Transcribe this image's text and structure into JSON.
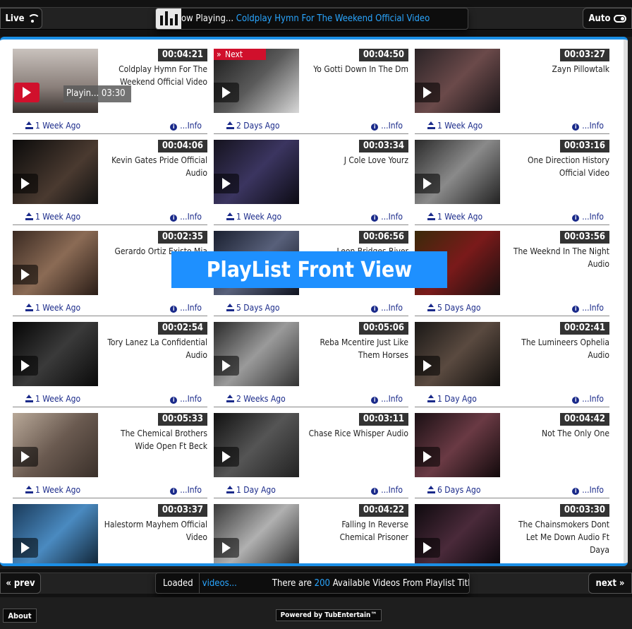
{
  "topbar": {
    "live_label": "Live",
    "auto_label": "Auto",
    "now_playing_prefix": "ow Playing...",
    "now_playing_title": "Coldplay Hymn For The Weekend Official Video"
  },
  "overlay": {
    "text": "PlayList Front View"
  },
  "badges": {
    "playing": "Playin... 03:30",
    "next": "Next"
  },
  "info_label": "...Info",
  "videos": [
    {
      "duration": "00:04:21",
      "title": "Coldplay Hymn For The Weekend Official Video",
      "ago": "1 Week Ago"
    },
    {
      "duration": "00:04:50",
      "title": "Yo Gotti Down In The Dm",
      "ago": "2 Days Ago"
    },
    {
      "duration": "00:03:27",
      "title": "Zayn Pillowtalk",
      "ago": "1 Week Ago"
    },
    {
      "duration": "00:04:06",
      "title": "Kevin Gates Pride Official Audio",
      "ago": "1 Week Ago"
    },
    {
      "duration": "00:03:34",
      "title": "J Cole Love Yourz",
      "ago": "1 Week Ago"
    },
    {
      "duration": "00:03:16",
      "title": "One Direction History Official Video",
      "ago": "1 Week Ago"
    },
    {
      "duration": "00:02:35",
      "title": "Gerardo Ortiz Existo Mia Official",
      "ago": "1 Week Ago"
    },
    {
      "duration": "00:06:56",
      "title": "Leon Bridges River",
      "ago": "5 Days Ago"
    },
    {
      "duration": "00:03:56",
      "title": "The Weeknd In The Night Audio",
      "ago": "5 Days Ago"
    },
    {
      "duration": "00:02:54",
      "title": "Tory Lanez La Confidential Audio",
      "ago": "1 Week Ago"
    },
    {
      "duration": "00:05:06",
      "title": "Reba Mcentire Just Like Them Horses",
      "ago": "2 Weeks Ago"
    },
    {
      "duration": "00:02:41",
      "title": "The Lumineers Ophelia Audio",
      "ago": "1 Day Ago"
    },
    {
      "duration": "00:05:33",
      "title": "The Chemical Brothers Wide Open Ft Beck",
      "ago": "1 Week Ago"
    },
    {
      "duration": "00:03:11",
      "title": "Chase Rice Whisper Audio",
      "ago": "1 Day Ago"
    },
    {
      "duration": "00:04:42",
      "title": "Not The Only One",
      "ago": "6 Days Ago"
    },
    {
      "duration": "00:03:37",
      "title": "Halestorm Mayhem Official Video",
      "ago": ""
    },
    {
      "duration": "00:04:22",
      "title": "Falling In Reverse Chemical Prisoner",
      "ago": ""
    },
    {
      "duration": "00:03:30",
      "title": "The Chainsmokers Dont Let Me Down Audio Ft Daya",
      "ago": ""
    }
  ],
  "bottombar": {
    "prev_label": "prev",
    "next_label": "next",
    "loaded_label": "Loaded",
    "loaded_link": "videos...",
    "count_prefix": "There are",
    "count": "200",
    "count_suffix": "Available Videos From Playlist Titl"
  },
  "footer": {
    "about_label": "About",
    "powered_label": "Powered by TubEntertain™"
  },
  "colors": {
    "accent": "#1b8fe6",
    "link": "#2aa6ff",
    "meta": "#1a2a8a",
    "play_red": "#d0102c"
  }
}
